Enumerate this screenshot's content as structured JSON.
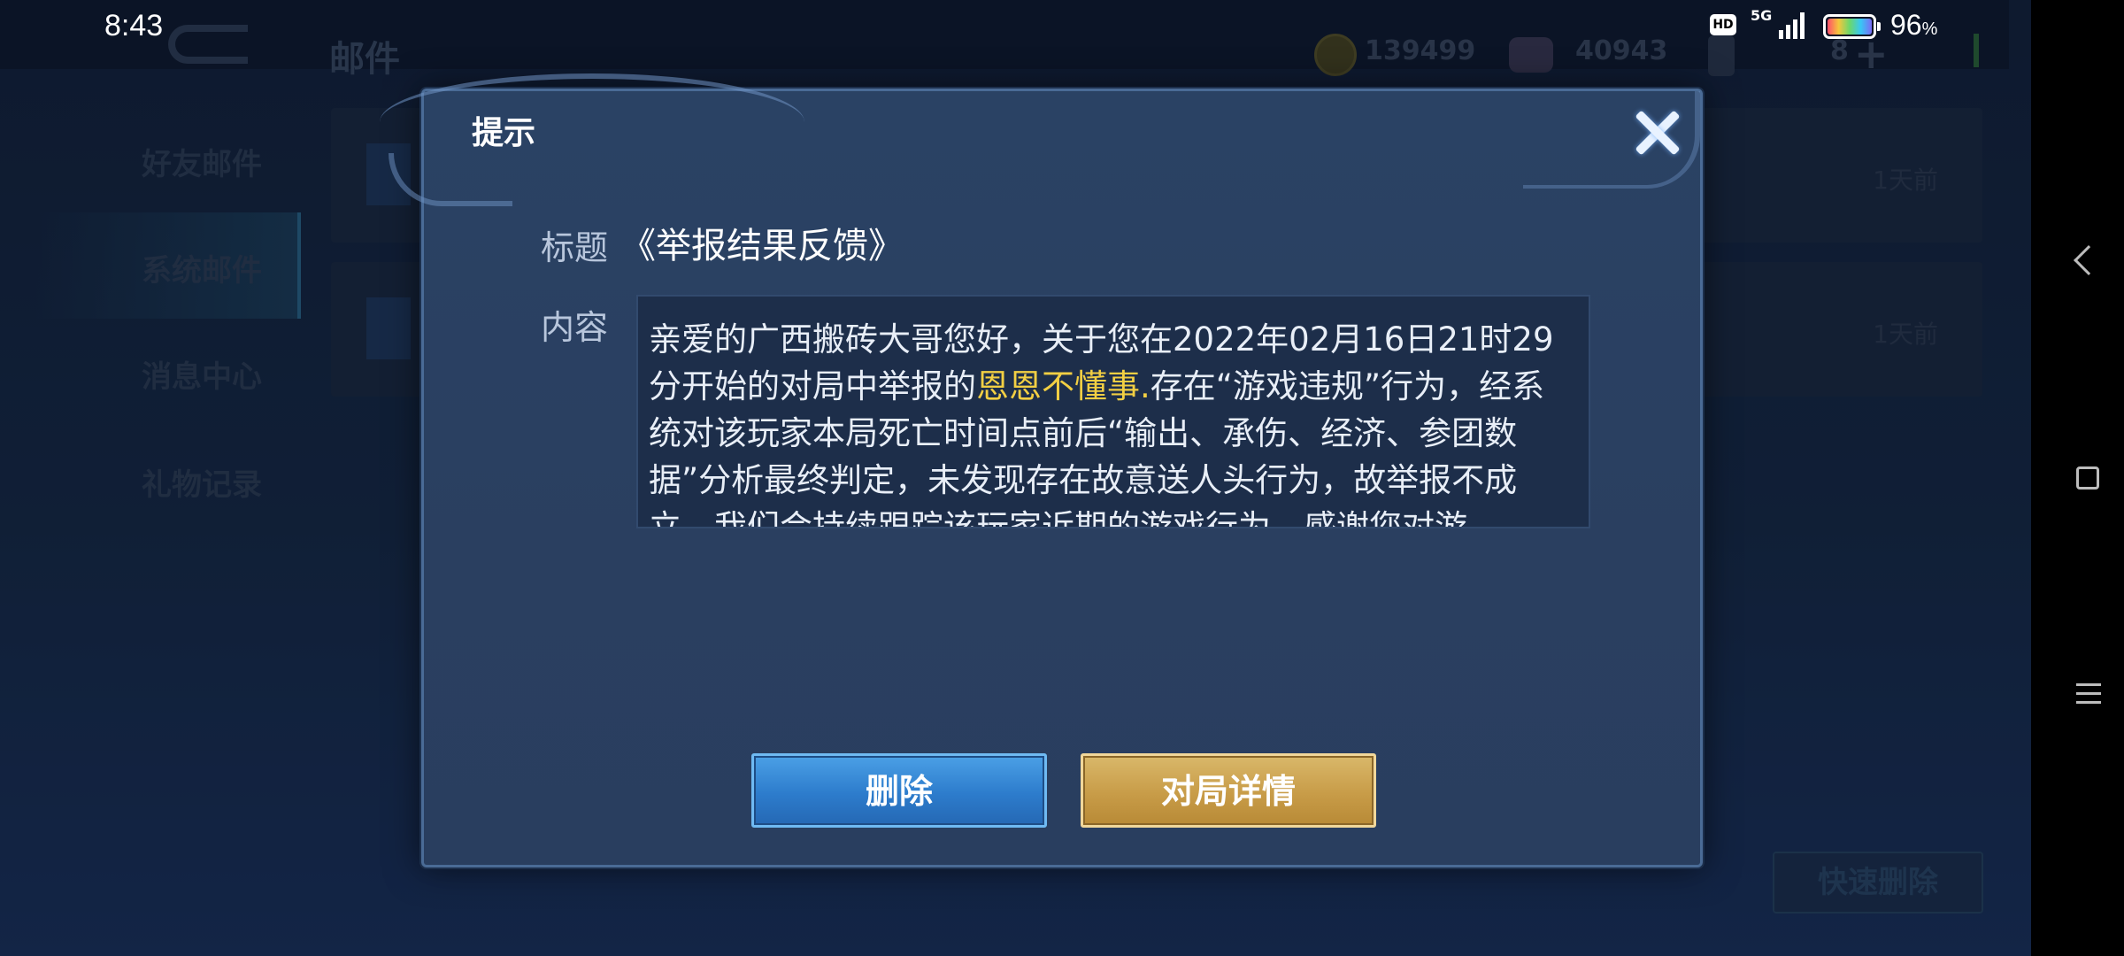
{
  "status_bar": {
    "time": "8:43",
    "hd_badge": "HD",
    "network": "5G",
    "battery": "96",
    "battery_unit": "%"
  },
  "background": {
    "page_title": "邮件",
    "gold_count": "139499",
    "gem_count": "40943",
    "item_count": "8",
    "sidebar": {
      "items": [
        {
          "label": "好友邮件"
        },
        {
          "label": "系统邮件"
        },
        {
          "label": "消息中心"
        },
        {
          "label": "礼物记录"
        }
      ],
      "active_index": 1
    },
    "mail_cards": [
      {
        "time": "1天前"
      },
      {
        "time": "1天前"
      }
    ],
    "quick_delete_label": "快速删除"
  },
  "dialog": {
    "title": "提示",
    "subject_label": "标题",
    "subject": "《举报结果反馈》",
    "content_label": "内容",
    "content_part1": "亲爱的广西搬砖大哥您好，关于您在2022年02月16日21时29分开始的对局中举报的",
    "content_highlight": "恩恩不懂事.",
    "content_part2": "存在“游戏违规”行为，经系统对该玩家本局死亡时间点前后“输出、承伤、经济、参团数据”分析最终判定，未发现存在故意送人头行为，故举报不成立，我们会持续跟踪该玩家近期的游戏行为，感谢您对游",
    "delete_label": "删除",
    "match_detail_label": "对局详情",
    "highlight_color": "#f2cf43"
  }
}
